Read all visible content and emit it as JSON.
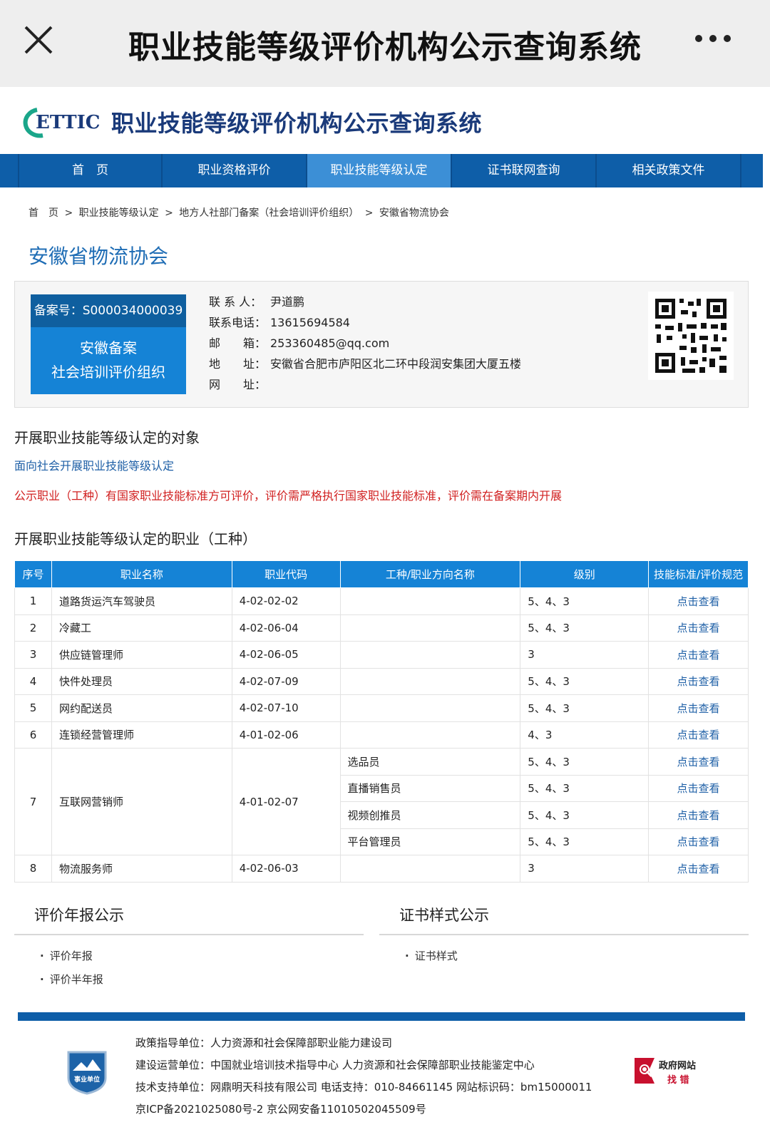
{
  "appbar": {
    "title": "职业技能等级评价机构公示查询系统"
  },
  "site": {
    "logo_text": "ETTIC",
    "title": "职业技能等级评价机构公示查询系统"
  },
  "nav": [
    "首　页",
    "职业资格评价",
    "职业技能等级认定",
    "证书联网查询",
    "相关政策文件"
  ],
  "breadcrumb": [
    "首　页",
    ">",
    "职业技能等级认定",
    ">",
    "地方人社部门备案（社会培训评价组织）",
    ">",
    "安徽省物流协会"
  ],
  "org": {
    "name": "安徽省物流协会",
    "record_no": "备案号：S000034000039",
    "badge_line1": "安徽备案",
    "badge_line2": "社会培训评价组织",
    "contact_k": "联 系 人：",
    "contact_v": "尹道鹏",
    "phone_k": "联系电话：",
    "phone_v": "13615694584",
    "email_k": "邮　　箱：",
    "email_v": "253360485@qq.com",
    "addr_k": "地　　址：",
    "addr_v": "安徽省合肥市庐阳区北二环中段润安集团大厦五楼",
    "web_k": "网　　址：",
    "web_v": ""
  },
  "target": {
    "heading": "开展职业技能等级认定的对象",
    "text": "面向社会开展职业技能等级认定",
    "notice": "公示职业（工种）有国家职业技能标准方可评价，评价需严格执行国家职业技能标准，评价需在备案期内开展"
  },
  "occupations": {
    "heading": "开展职业技能等级认定的职业（工种）",
    "headers": [
      "序号",
      "职业名称",
      "职业代码",
      "工种/职业方向名称",
      "级别",
      "技能标准/评价规范"
    ],
    "link": "点击查看",
    "rows": [
      {
        "no": "1",
        "name": "道路货运汽车驾驶员",
        "code": "4-02-02-02",
        "subs": [
          {
            "dir": "",
            "level": "5、4、3"
          }
        ]
      },
      {
        "no": "2",
        "name": "冷藏工",
        "code": "4-02-06-04",
        "subs": [
          {
            "dir": "",
            "level": "5、4、3"
          }
        ]
      },
      {
        "no": "3",
        "name": "供应链管理师",
        "code": "4-02-06-05",
        "subs": [
          {
            "dir": "",
            "level": "3"
          }
        ]
      },
      {
        "no": "4",
        "name": "快件处理员",
        "code": "4-02-07-09",
        "subs": [
          {
            "dir": "",
            "level": "5、4、3"
          }
        ]
      },
      {
        "no": "5",
        "name": "网约配送员",
        "code": "4-02-07-10",
        "subs": [
          {
            "dir": "",
            "level": "5、4、3"
          }
        ]
      },
      {
        "no": "6",
        "name": "连锁经营管理师",
        "code": "4-01-02-06",
        "subs": [
          {
            "dir": "",
            "level": "4、3"
          }
        ]
      },
      {
        "no": "7",
        "name": "互联网营销师",
        "code": "4-01-02-07",
        "subs": [
          {
            "dir": "选品员",
            "level": "5、4、3"
          },
          {
            "dir": "直播销售员",
            "level": "5、4、3"
          },
          {
            "dir": "视频创推员",
            "level": "5、4、3"
          },
          {
            "dir": "平台管理员",
            "level": "5、4、3"
          }
        ]
      },
      {
        "no": "8",
        "name": "物流服务师",
        "code": "4-02-06-03",
        "subs": [
          {
            "dir": "",
            "level": "3"
          }
        ]
      }
    ]
  },
  "annual": {
    "heading": "评价年报公示",
    "items": [
      "评价年报",
      "评价半年报"
    ]
  },
  "cert": {
    "heading": "证书样式公示",
    "items": [
      "证书样式"
    ]
  },
  "footer": {
    "l1": "政策指导单位：人力资源和社会保障部职业能力建设司",
    "l2": "建设运营单位：中国就业培训技术指导中心 人力资源和社会保障部职业技能鉴定中心",
    "l3": "技术支持单位：网鼎明天科技有限公司   电话支持：010-84661145   网站标识码：bm15000011",
    "l4": "京ICP备2021025080号-2    京公网安备11010502045509号",
    "emblem": "事业单位",
    "find1": "政府网站",
    "find2": "找 错"
  },
  "colors": {
    "nav": "#0e5ea8",
    "nav_active": "#3c8fd6",
    "header_blue": "#1583d6",
    "link": "#1e5fa6",
    "notice": "#d12020"
  }
}
